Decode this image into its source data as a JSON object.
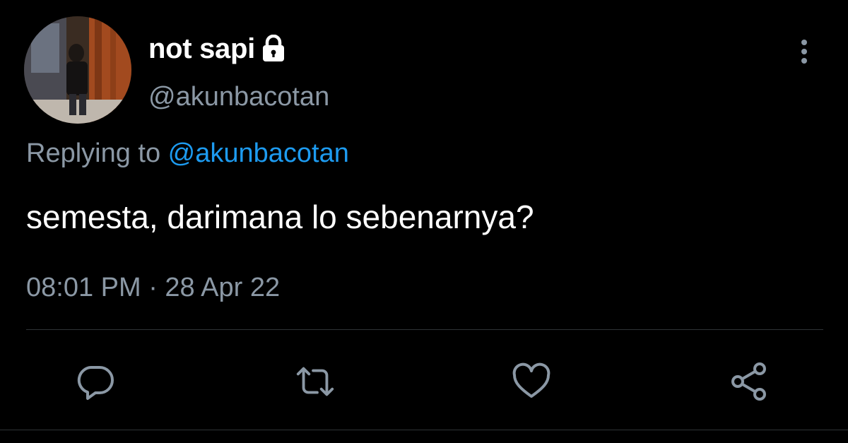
{
  "user": {
    "display_name": "not sapi",
    "handle": "@akunbacotan",
    "avatar_icon": "profile-photo",
    "protected_icon": "lock-icon"
  },
  "reply": {
    "prefix": "Replying to ",
    "mention": "@akunbacotan"
  },
  "tweet": {
    "text": "semesta, darimana lo sebenarnya?",
    "timestamp": "08:01 PM · 28 Apr 22"
  },
  "menu": {
    "icon": "more-vertical-icon"
  },
  "actions": [
    {
      "name": "reply",
      "icon": "comment-icon"
    },
    {
      "name": "retweet",
      "icon": "retweet-icon"
    },
    {
      "name": "like",
      "icon": "heart-icon"
    },
    {
      "name": "share",
      "icon": "share-icon"
    }
  ],
  "colors": {
    "background": "#000000",
    "primary_text": "#ffffff",
    "secondary_text": "#8b98a5",
    "accent": "#1d9bf0",
    "divider": "#2f3336"
  }
}
